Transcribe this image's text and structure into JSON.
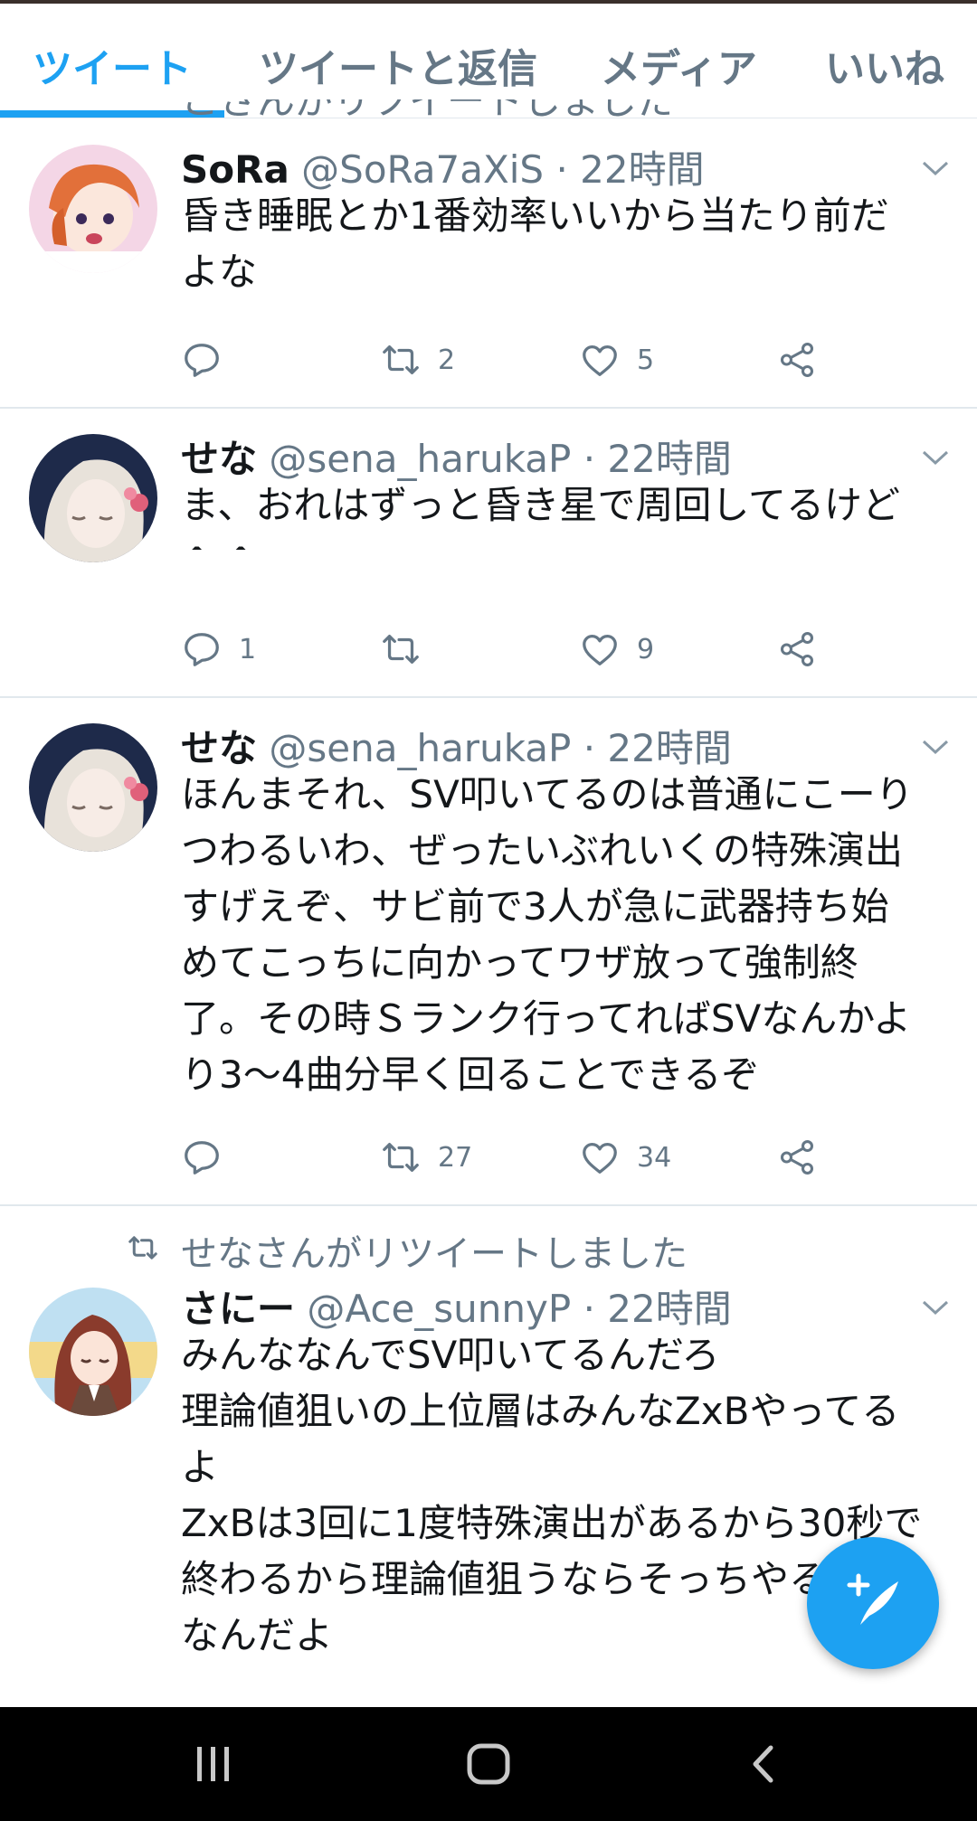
{
  "tabs": [
    {
      "label": "ツイート"
    },
    {
      "label": "ツイートと返信"
    },
    {
      "label": "メディア"
    },
    {
      "label": "いいね"
    }
  ],
  "partial_top": {
    "text": "こさんがリツイートしました"
  },
  "tweets": [
    {
      "name": "SoRa",
      "handle": "@SoRa7aXiS",
      "time": "· 22時間",
      "text": "昏き睡眠とか1番効率いいから当たり前だ\nよな",
      "reply_count": "",
      "retweet_count": "2",
      "like_count": "5"
    },
    {
      "name": "せな",
      "handle": "@sena_harukaP",
      "time": "· 22時間",
      "text": "ま、おれはずっと昏き星で周回してるけど\n^ ^",
      "reply_count": "1",
      "retweet_count": "",
      "like_count": "9"
    },
    {
      "name": "せな",
      "handle": "@sena_harukaP",
      "time": "· 22時間",
      "text": "ほんまそれ、SV叩いてるのは普通にこーり\nつわるいわ、ぜったいぶれいくの特殊演出\nすげえぞ、サビ前で3人が急に武器持ち始\nめてこっちに向かってワザ放って強制終\n了。その時Ｓランク行ってればSVなんかよ\nり3～4曲分早く回ることできるぞ",
      "reply_count": "",
      "retweet_count": "27",
      "like_count": "34"
    },
    {
      "retweet_label": "せなさんがリツイートしました",
      "name": "さにー",
      "handle": "@Ace_sunnyP",
      "time": "· 22時間",
      "text": "みんななんでSV叩いてるんだろ\n理論値狙いの上位層はみんなZxBやってる\nよ\nZxBは3回に1度特殊演出があるから30秒で\n終わるから理論値狙うならそっちやる\nなんだよ"
    }
  ],
  "icons": {
    "reply": "reply-icon",
    "retweet": "retweet-icon",
    "like": "heart-icon",
    "share": "share-icon",
    "compose": "compose-tweet-icon"
  },
  "colors": {
    "accent": "#1da1f2",
    "muted": "#657786"
  }
}
